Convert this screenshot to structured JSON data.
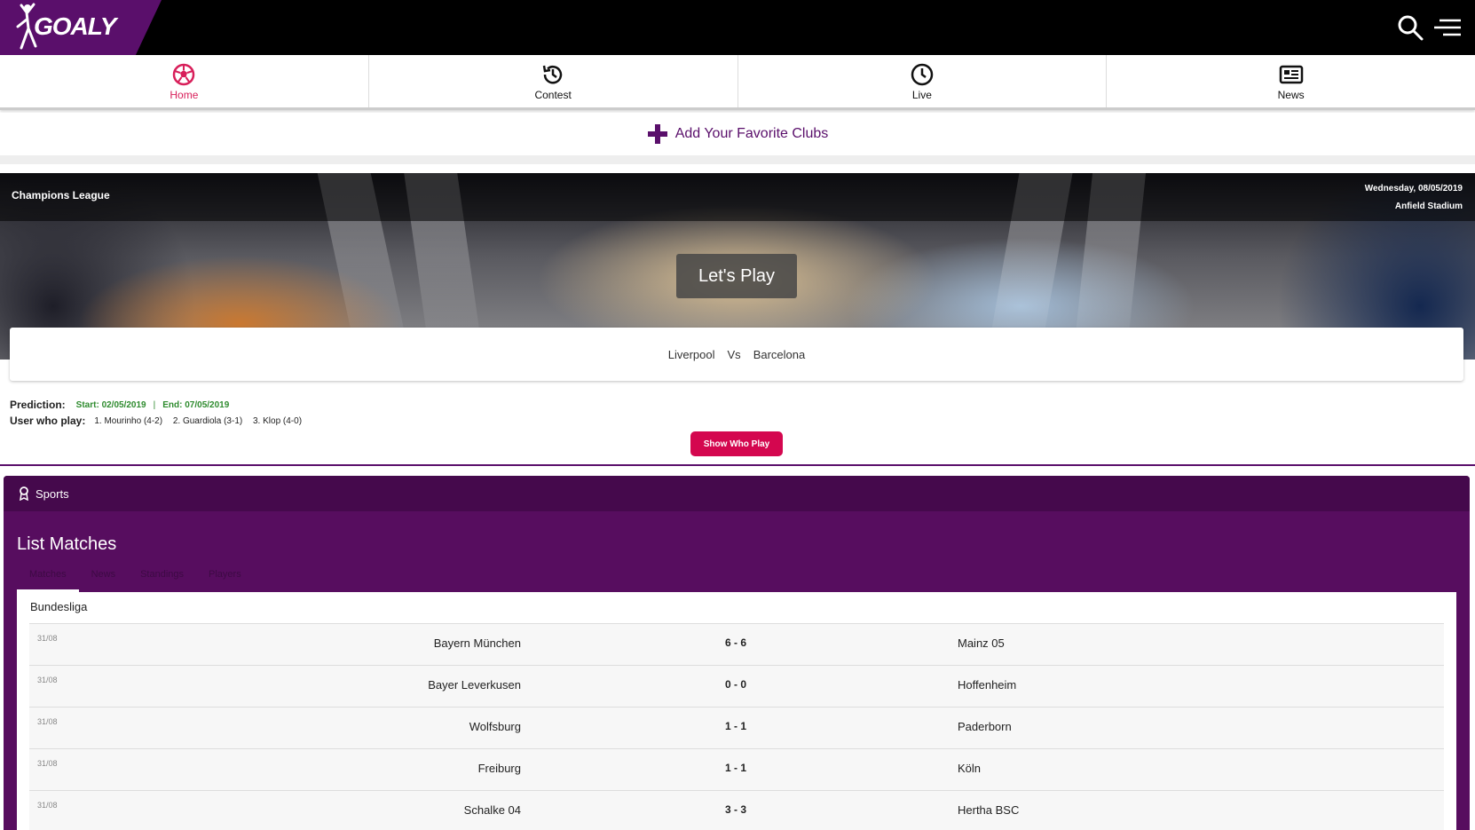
{
  "brand": {
    "logo_text": "GOALY",
    "accent": "#5a0f6b",
    "highlight": "#d81f5a"
  },
  "topbar": {
    "search_icon": "search-icon",
    "menu_icon": "menu-icon"
  },
  "nav": {
    "items": [
      {
        "label": "Home",
        "icon": "football-icon",
        "active": true
      },
      {
        "label": "Contest",
        "icon": "history-icon",
        "active": false
      },
      {
        "label": "Live",
        "icon": "clock-icon",
        "active": false
      },
      {
        "label": "News",
        "icon": "newspaper-icon",
        "active": false
      }
    ]
  },
  "add_clubs": {
    "label": "Add Your Favorite Clubs"
  },
  "featured": {
    "league": "Champions League",
    "date": "Wednesday, 08/05/2019",
    "venue": "Anfield Stadium",
    "play_label": "Let's Play",
    "home": "Liverpool",
    "vs": "Vs",
    "away": "Barcelona"
  },
  "prediction": {
    "label": "Prediction:",
    "start": "Start: 02/05/2019",
    "separator": "|",
    "end": "End: 07/05/2019",
    "users_label": "User who play:",
    "users": [
      "1. Mourinho (4-2)",
      "2. Guardiola (3-1)",
      "3. Klop (4-0)"
    ],
    "show_button": "Show Who Play"
  },
  "sports": {
    "header": "Sports",
    "title": "List Matches",
    "tabs": [
      "Matches",
      "News",
      "Standings",
      "Players"
    ],
    "league": "Bundesliga",
    "matches": [
      {
        "date": "31/08",
        "home": "Bayern München",
        "score": "6 - 6",
        "away": "Mainz 05"
      },
      {
        "date": "31/08",
        "home": "Bayer Leverkusen",
        "score": "0 - 0",
        "away": "Hoffenheim"
      },
      {
        "date": "31/08",
        "home": "Wolfsburg",
        "score": "1 - 1",
        "away": "Paderborn"
      },
      {
        "date": "31/08",
        "home": "Freiburg",
        "score": "1 - 1",
        "away": "Köln"
      },
      {
        "date": "31/08",
        "home": "Schalke 04",
        "score": "3 - 3",
        "away": "Hertha BSC"
      }
    ]
  }
}
